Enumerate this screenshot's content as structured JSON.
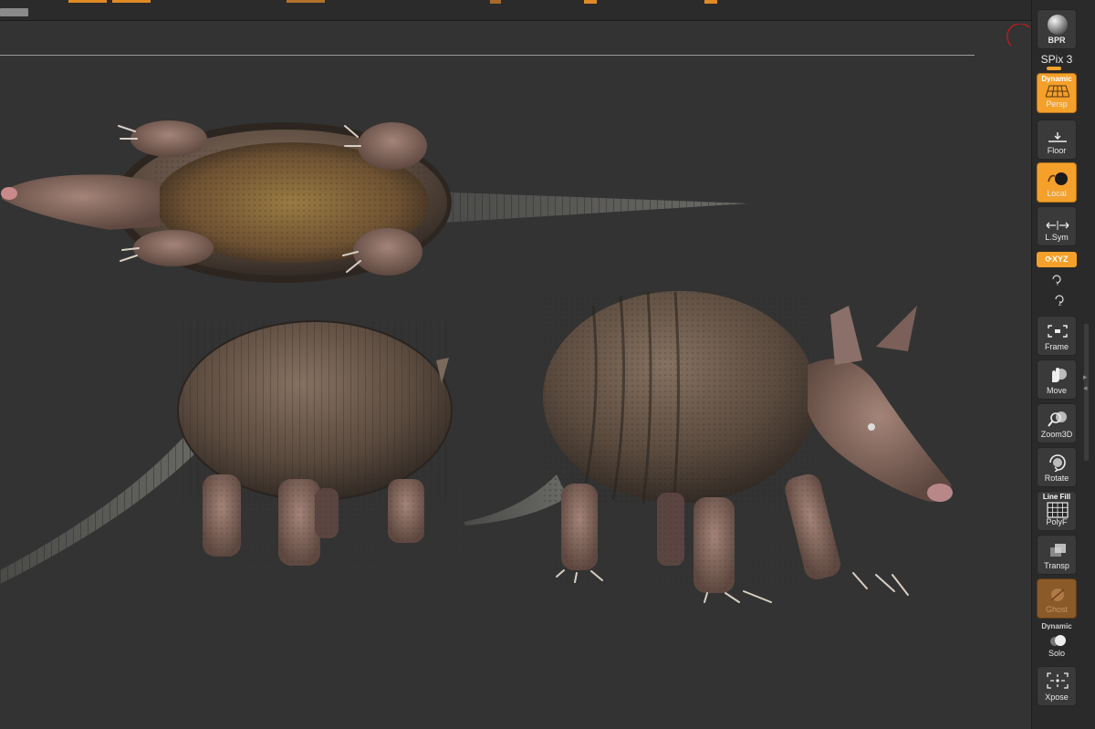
{
  "shelf": {
    "bpr": "BPR",
    "spix": "SPix 3",
    "persp": {
      "top_label": "Dynamic",
      "label": "Persp"
    },
    "floor": "Floor",
    "local": "Local",
    "lsym": "L.Sym",
    "xyz": "XYZ",
    "frame": "Frame",
    "move": "Move",
    "zoom3d": "Zoom3D",
    "rotate": "Rotate",
    "polyf": {
      "top_label": "Line Fill",
      "label": "PolyF"
    },
    "transp": "Transp",
    "ghost": "Ghost",
    "solo": {
      "top_label": "Dynamic",
      "label": "Solo"
    },
    "xpose": "Xpose"
  },
  "colors": {
    "accent": "#f4a02a",
    "background": "#333333",
    "shelf": "#2a2a2a"
  },
  "icons": [
    "bpr-sphere-icon",
    "persp-grid-icon",
    "floor-icon",
    "local-icon",
    "lsym-icon",
    "xyz-rotate-icon",
    "y-rotate-icon",
    "z-rotate-icon",
    "frame-icon",
    "move-hand-icon",
    "zoom-icon",
    "rotate-icon",
    "polyf-grid-icon",
    "transp-icon",
    "ghost-icon",
    "solo-icon",
    "xpose-icon"
  ]
}
